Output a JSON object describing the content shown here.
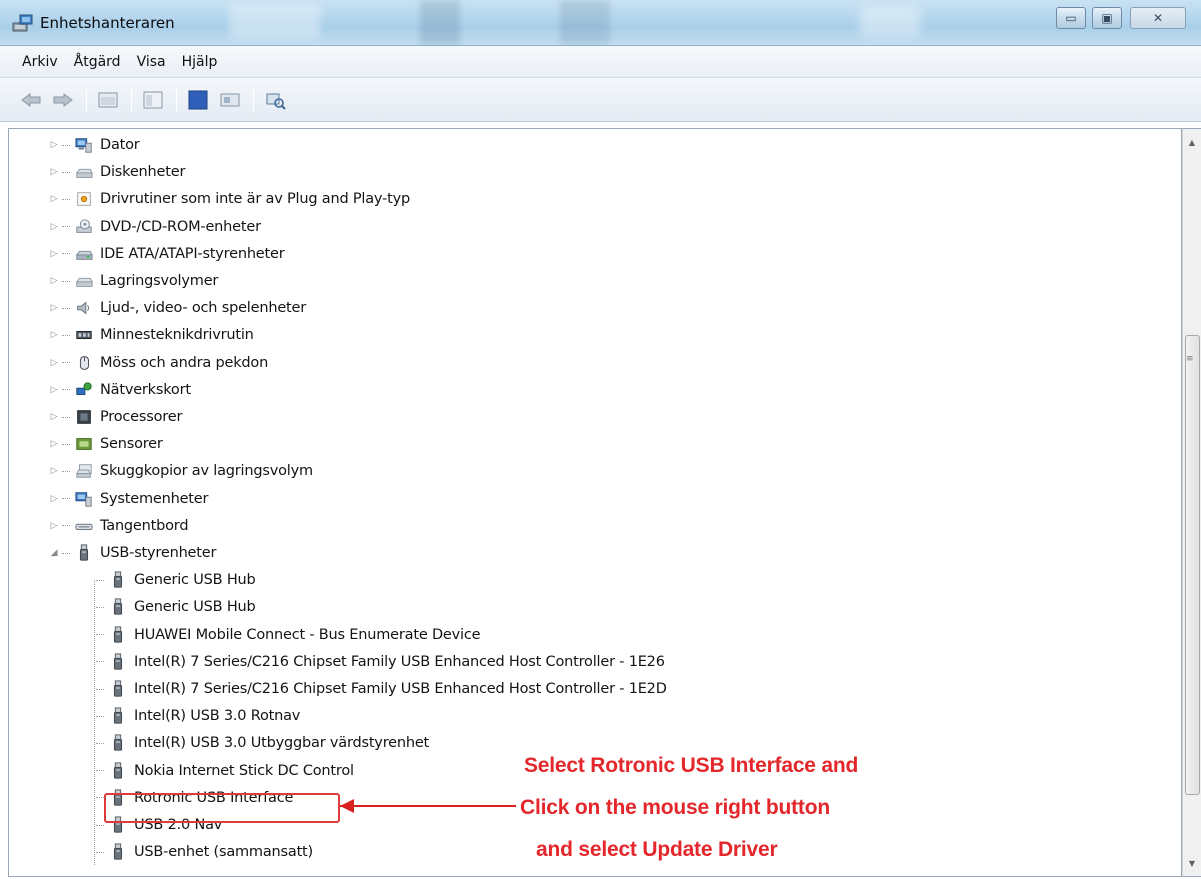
{
  "window": {
    "title": "Enhetshanteraren",
    "min_glyph": "▭",
    "max_glyph": "▣",
    "close_glyph": "✕"
  },
  "menu": [
    "Arkiv",
    "Åtgärd",
    "Visa",
    "Hjälp"
  ],
  "toolbar": {
    "help_glyph": "?"
  },
  "tree": {
    "collapsed_glyph": "▷",
    "expanded_glyph": "◢",
    "categories": [
      {
        "label": "Dator",
        "icon": "computer-icon"
      },
      {
        "label": "Diskenheter",
        "icon": "disk-drive-icon"
      },
      {
        "label": "Drivrutiner som inte är av Plug and Play-typ",
        "icon": "driver-icon"
      },
      {
        "label": "DVD-/CD-ROM-enheter",
        "icon": "dvd-drive-icon"
      },
      {
        "label": "IDE ATA/ATAPI-styrenheter",
        "icon": "ide-controller-icon"
      },
      {
        "label": "Lagringsvolymer",
        "icon": "storage-volume-icon"
      },
      {
        "label": "Ljud-, video- och spelenheter",
        "icon": "speaker-icon"
      },
      {
        "label": "Minnesteknikdrivrutin",
        "icon": "memory-icon"
      },
      {
        "label": "Möss och andra pekdon",
        "icon": "mouse-icon"
      },
      {
        "label": "Nätverkskort",
        "icon": "network-icon"
      },
      {
        "label": "Processorer",
        "icon": "processor-icon"
      },
      {
        "label": "Sensorer",
        "icon": "sensor-icon"
      },
      {
        "label": "Skuggkopior av lagringsvolym",
        "icon": "shadow-copy-icon"
      },
      {
        "label": "Systemenheter",
        "icon": "system-device-icon"
      },
      {
        "label": "Tangentbord",
        "icon": "keyboard-icon"
      },
      {
        "label": "USB-styrenheter",
        "icon": "usb-icon"
      }
    ],
    "usb_children": [
      "Generic USB Hub",
      "Generic USB Hub",
      "HUAWEI Mobile Connect - Bus Enumerate Device",
      "Intel(R) 7 Series/C216 Chipset Family USB Enhanced Host Controller - 1E26",
      "Intel(R) 7 Series/C216 Chipset Family USB Enhanced Host Controller - 1E2D",
      "Intel(R) USB 3.0 Rotnav",
      "Intel(R) USB 3.0 Utbyggbar värdstyrenhet",
      "Nokia Internet Stick DC Control",
      "Rotronic USB Interface",
      "USB 2.0 Nav",
      "USB-enhet (sammansatt)"
    ]
  },
  "annotation": {
    "line1": "Select Rotronic USB Interface and",
    "line2": "Click on the mouse right  button",
    "line3": "and select Update Driver",
    "color": "#e3272b"
  },
  "scrollbar": {
    "up_glyph": "▲",
    "down_glyph": "▼",
    "grip_glyph": "≡"
  }
}
